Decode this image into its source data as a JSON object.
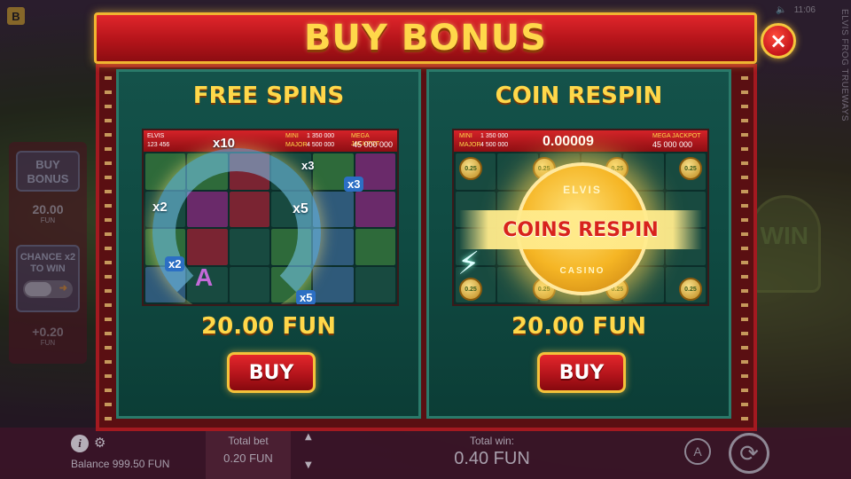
{
  "modal": {
    "title": "BUY BONUS",
    "close_symbol": "×",
    "options": [
      {
        "title": "FREE SPINS",
        "price": "20.00 FUN",
        "buy_label": "BUY",
        "preview": {
          "jackpot": {
            "logo": "ELVIS",
            "left_value": "123 456",
            "mini_label": "MINI",
            "mini_value": "1 350 000",
            "major_label": "MAJOR",
            "major_value": "4 500 000",
            "mega_label": "MEGA JACKPOT",
            "mega_value": "45 000 000"
          },
          "multipliers": [
            "x10",
            "x2",
            "x3",
            "x5",
            "x2",
            "x3",
            "x5"
          ],
          "symbol_letter": "A"
        }
      },
      {
        "title": "COIN RESPIN",
        "price": "20.00 FUN",
        "buy_label": "BUY",
        "preview": {
          "jackpot": {
            "mini_label": "MINI",
            "mini_value": "1 350 000",
            "major_label": "MAJOR",
            "major_value": "4 500 000",
            "center_value": "0.00009",
            "mega_label": "MEGA JACKPOT",
            "mega_value": "45 000 000"
          },
          "medal_top": "ELVIS",
          "medal_bottom": "CASINO",
          "banner_text": "COINS RESPIN",
          "coin_values": [
            "0.25",
            "0.25",
            "0.25",
            "0.25",
            "0.25",
            "0.25",
            "0.25",
            "0.25"
          ]
        }
      }
    ]
  },
  "background": {
    "brand_badge": "B",
    "clock": "11:06",
    "speaker_icon": "speaker-icon",
    "game_title": "ELVIS FROG TRUEWAYS",
    "side_panel": {
      "buy_bonus_label": "BUY BONUS",
      "buy_bonus_price": "20.00",
      "buy_bonus_unit": "FUN",
      "chance_label": "CHANCE x2 TO WIN",
      "bet_increase": "+0.20",
      "bet_increase_unit": "FUN"
    },
    "right_deco_text": "WIN"
  },
  "bottom_bar": {
    "info_symbol": "i",
    "gear_symbol": "⚙",
    "balance_label": "Balance",
    "balance_value": "999.50 FUN",
    "total_bet_label": "Total bet",
    "total_bet_value": "0.20 FUN",
    "bet_up_symbol": "▲",
    "bet_down_symbol": "▼",
    "total_win_label": "Total win:",
    "total_win_value": "0.40 FUN",
    "auto_symbol": "A",
    "spin_symbol": "⟳"
  },
  "colors": {
    "title_text": "#ffd84a",
    "title_bar": "#c4161c",
    "card_bg": "#124c44",
    "buy_button": "#c4161c",
    "gold_border": "#f4c23a"
  }
}
